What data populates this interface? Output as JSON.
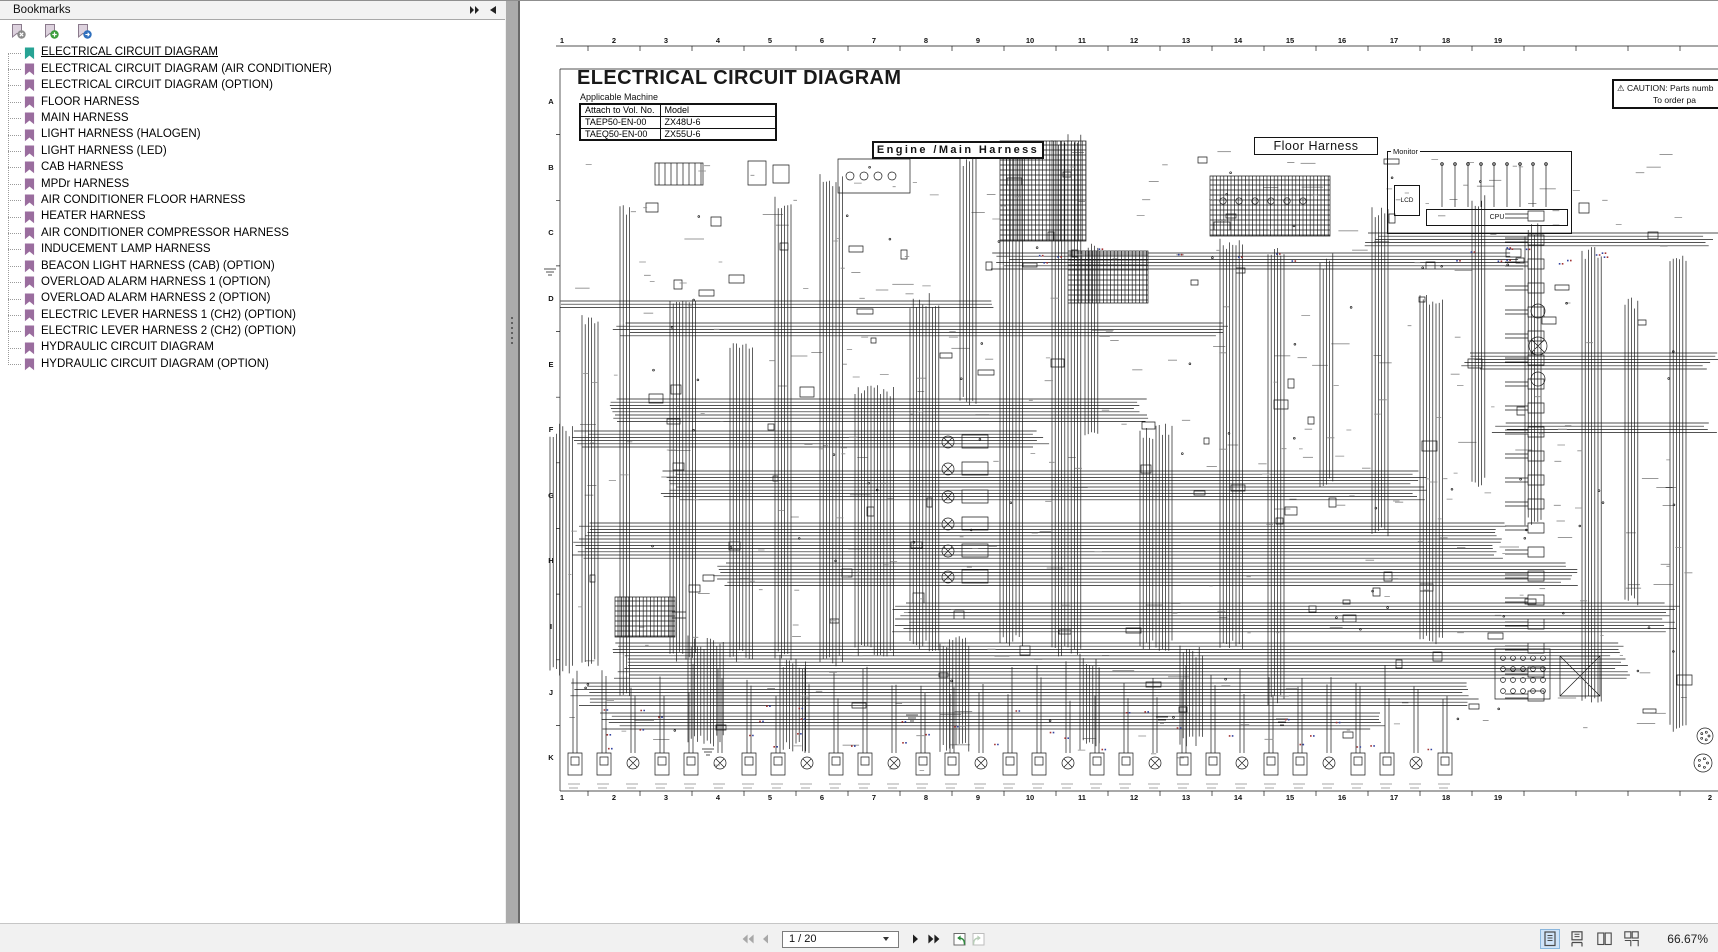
{
  "bookmarks_panel": {
    "title": "Bookmarks",
    "items": [
      {
        "label": "ELECTRICAL CIRCUIT DIAGRAM",
        "selected": true
      },
      {
        "label": "ELECTRICAL CIRCUIT DIAGRAM (AIR CONDITIONER)",
        "selected": false
      },
      {
        "label": "ELECTRICAL CIRCUIT DIAGRAM (OPTION)",
        "selected": false
      },
      {
        "label": "FLOOR HARNESS",
        "selected": false
      },
      {
        "label": "MAIN HARNESS",
        "selected": false
      },
      {
        "label": "LIGHT HARNESS (HALOGEN)",
        "selected": false
      },
      {
        "label": "LIGHT HARNESS (LED)",
        "selected": false
      },
      {
        "label": "CAB HARNESS",
        "selected": false
      },
      {
        "label": "MPDr HARNESS",
        "selected": false
      },
      {
        "label": "AIR CONDITIONER FLOOR HARNESS",
        "selected": false
      },
      {
        "label": "HEATER HARNESS",
        "selected": false
      },
      {
        "label": "AIR CONDITIONER COMPRESSOR HARNESS",
        "selected": false
      },
      {
        "label": "INDUCEMENT LAMP HARNESS",
        "selected": false
      },
      {
        "label": "BEACON LIGHT HARNESS (CAB) (OPTION)",
        "selected": false
      },
      {
        "label": "OVERLOAD ALARM HARNESS 1 (OPTION)",
        "selected": false
      },
      {
        "label": "OVERLOAD ALARM HARNESS 2 (OPTION)",
        "selected": false
      },
      {
        "label": "ELECTRIC LEVER HARNESS 1 (CH2) (OPTION)",
        "selected": false
      },
      {
        "label": "ELECTRIC LEVER HARNESS 2 (CH2) (OPTION)",
        "selected": false
      },
      {
        "label": "HYDRAULIC CIRCUIT DIAGRAM",
        "selected": false
      },
      {
        "label": "HYDRAULIC CIRCUIT DIAGRAM (OPTION)",
        "selected": false
      }
    ]
  },
  "page_content": {
    "title": "ELECTRICAL CIRCUIT DIAGRAM",
    "subtitle": "Applicable Machine",
    "machine_table": {
      "headers": [
        "Attach to Vol. No.",
        "Model"
      ],
      "rows": [
        [
          "TAEP50-EN-00",
          "ZX48U-6"
        ],
        [
          "TAEQ50-EN-00",
          "ZX55U-6"
        ]
      ]
    },
    "caution": {
      "icon": "⚠",
      "line1": "CAUTION: Parts numb",
      "line2": "To order pa"
    },
    "section_labels": {
      "engine": "Engine /Main Harness",
      "floor": "Floor Harness",
      "monitor": "Monitor",
      "lcd": "LCD",
      "cpu": "CPU"
    },
    "grid": {
      "columns": [
        "1",
        "2",
        "3",
        "4",
        "5",
        "6",
        "7",
        "8",
        "9",
        "10",
        "11",
        "12",
        "13",
        "14",
        "15",
        "16",
        "17",
        "18",
        "19"
      ],
      "rows": [
        "A",
        "B",
        "C",
        "D",
        "E",
        "F",
        "G",
        "H",
        "I",
        "J",
        "K"
      ],
      "bottom_extra": "2"
    }
  },
  "bottom_toolbar": {
    "page_field_value": "1 / 20",
    "zoom_value": "66.67%"
  },
  "colors": {
    "bookmark_selected": "#27a394",
    "bookmark_default": "#9a6d9e",
    "badge_delete": "#8a8a8a",
    "badge_add": "#3d9e3d",
    "badge_goto": "#2f6fbd",
    "ink": "#1a1a1a",
    "view_icon_highlight": "#cfe3f8"
  }
}
